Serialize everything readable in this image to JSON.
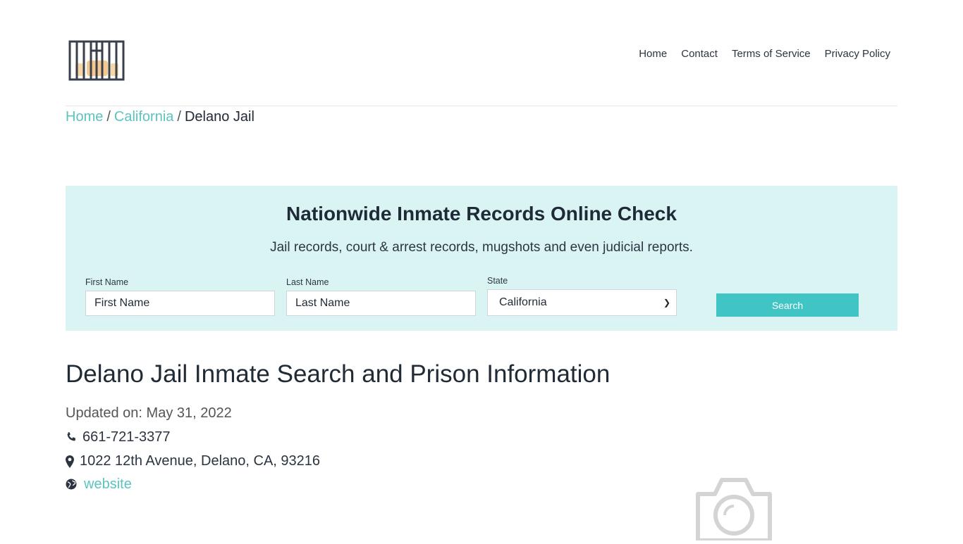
{
  "header": {
    "logo_icon": "jail-bars-logo-icon",
    "nav": [
      "Home",
      "Contact",
      "Terms of Service",
      "Privacy Policy"
    ]
  },
  "breadcrumb": {
    "items": [
      "Home",
      "California"
    ],
    "current": "Delano Jail",
    "separator": "/"
  },
  "search_panel": {
    "title": "Nationwide Inmate Records Online Check",
    "subtitle": "Jail records, court & arrest records, mugshots and even judicial reports.",
    "first_name": {
      "label": "First Name",
      "value": "First Name"
    },
    "last_name": {
      "label": "Last Name",
      "value": "Last Name"
    },
    "state": {
      "label": "State",
      "selected": "California"
    },
    "button": "Search",
    "colors": {
      "background": "#daf4f4",
      "button": "#40c4c4"
    }
  },
  "main": {
    "title": "Delano Jail Inmate Search and Prison Information",
    "updated": "Updated on: May 31, 2022",
    "phone": "661-721-3377",
    "address": "1022 12th Avenue, Delano, CA, 93216",
    "website_label": "website",
    "image_placeholder_icon": "camera-icon"
  },
  "colors": {
    "accent": "#5cc4c0",
    "text": "#212b36"
  }
}
